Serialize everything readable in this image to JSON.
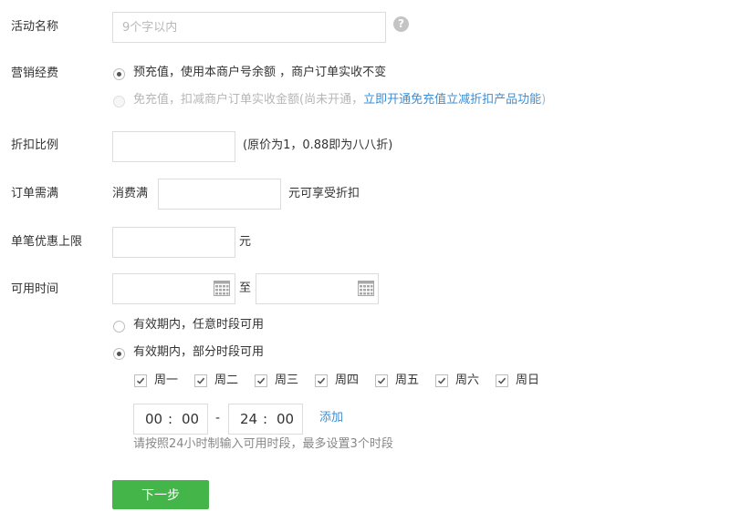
{
  "form": {
    "activity_name": {
      "label": "活动名称",
      "placeholder": "9个字以内"
    },
    "marketing_fee": {
      "label": "营销经费",
      "option_prepaid": "预充值，使用本商户号余额 ，商户订单实收不变",
      "option_free_prefix": "免充值，扣减商户订单实收金额(尚未开通，",
      "option_free_link": "立即开通免充值立减折扣产品功能",
      "option_free_suffix": ")"
    },
    "discount": {
      "label": "折扣比例",
      "hint": "(原价为1，0.88即为八八折)"
    },
    "order_min": {
      "label": "订单需满",
      "prefix": "消费满",
      "suffix": "元可享受折扣"
    },
    "single_max": {
      "label": "单笔优惠上限",
      "suffix": "元"
    },
    "available_time": {
      "label": "可用时间",
      "separator": "至",
      "option_any": "有效期内，任意时段可用",
      "option_partial": "有效期内，部分时段可用",
      "days": [
        "周一",
        "周二",
        "周三",
        "周四",
        "周五",
        "周六",
        "周日"
      ],
      "start_hour": "00",
      "start_minute": "00",
      "range_dash": "-",
      "end_hour": "24",
      "end_minute": "00",
      "colon": ":",
      "add_link": "添加",
      "hint": "请按照24小时制输入可用时段，最多设置3个时段"
    },
    "next_button": "下一步"
  },
  "colors": {
    "accent_green": "#44b549",
    "link_blue": "#3b8fd6"
  },
  "icons": {
    "help": "question-circle-icon",
    "calendar": "calendar-icon",
    "check": "checkmark-icon"
  }
}
